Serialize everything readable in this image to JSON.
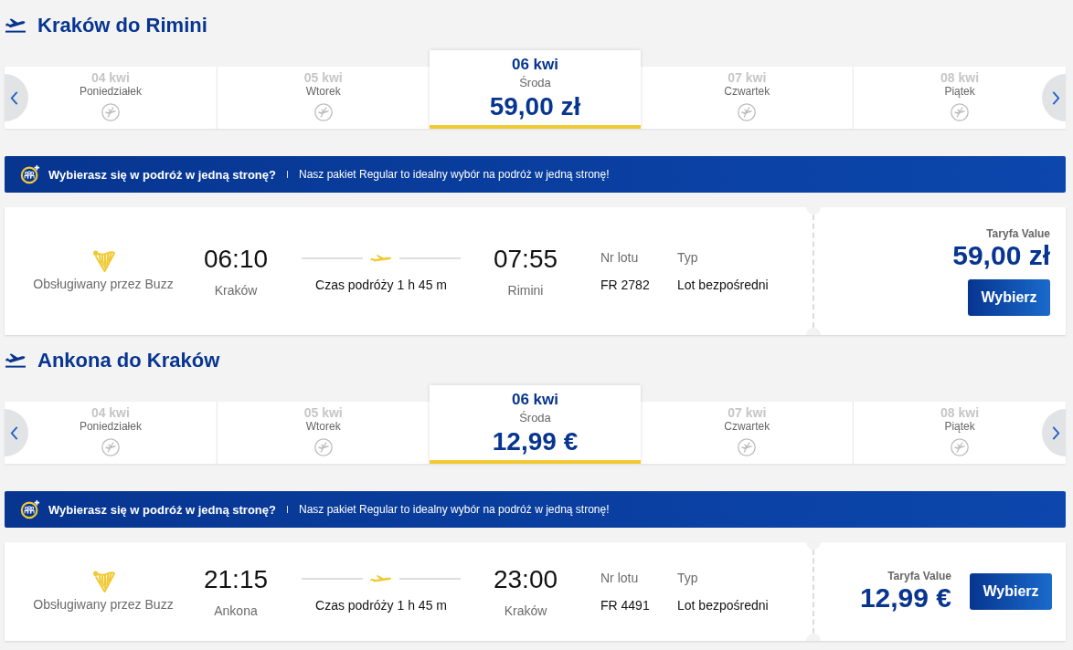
{
  "sections": [
    {
      "title": "Kraków do Rimini",
      "dates": [
        {
          "date": "04 kwi",
          "weekday": "Poniedziałek",
          "selected": false
        },
        {
          "date": "05 kwi",
          "weekday": "Wtorek",
          "selected": false
        },
        {
          "date": "06 kwi",
          "weekday": "Środa",
          "price": "59,00 zł",
          "selected": true
        },
        {
          "date": "07 kwi",
          "weekday": "Czwartek",
          "selected": false
        },
        {
          "date": "08 kwi",
          "weekday": "Piątek",
          "selected": false
        }
      ],
      "banner": {
        "title": "Wybierasz się w podróż w jedną stronę?",
        "text": "Nasz pakiet Regular to idealny wybór na podróż w jedną stronę!"
      },
      "flight": {
        "operator": "Obsługiwany przez Buzz",
        "departure": {
          "time": "06:10",
          "city": "Kraków"
        },
        "duration": "Czas podróży 1 h 45 m",
        "arrival": {
          "time": "07:55",
          "city": "Rimini"
        },
        "flight_number_label": "Nr lotu",
        "flight_number": "FR 2782",
        "type_label": "Typ",
        "type": "Lot bezpośredni",
        "fare_label": "Taryfa Value",
        "price": "59,00 zł",
        "button": "Wybierz"
      }
    },
    {
      "title": "Ankona do Kraków",
      "dates": [
        {
          "date": "04 kwi",
          "weekday": "Poniedziałek",
          "selected": false
        },
        {
          "date": "05 kwi",
          "weekday": "Wtorek",
          "selected": false
        },
        {
          "date": "06 kwi",
          "weekday": "Środa",
          "price": "12,99 €",
          "selected": true
        },
        {
          "date": "07 kwi",
          "weekday": "Czwartek",
          "selected": false
        },
        {
          "date": "08 kwi",
          "weekday": "Piątek",
          "selected": false
        }
      ],
      "banner": {
        "title": "Wybierasz się w podróż w jedną stronę?",
        "text": "Nasz pakiet Regular to idealny wybór na podróż w jedną stronę!"
      },
      "flight": {
        "operator": "Obsługiwany przez Buzz",
        "departure": {
          "time": "21:15",
          "city": "Ankona"
        },
        "duration": "Czas podróży 1 h 45 m",
        "arrival": {
          "time": "23:00",
          "city": "Kraków"
        },
        "flight_number_label": "Nr lotu",
        "flight_number": "FR 4491",
        "type_label": "Typ",
        "type": "Lot bezpośredni",
        "fare_label": "Taryfa Value",
        "price": "12,99 €",
        "button": "Wybierz"
      }
    }
  ]
}
